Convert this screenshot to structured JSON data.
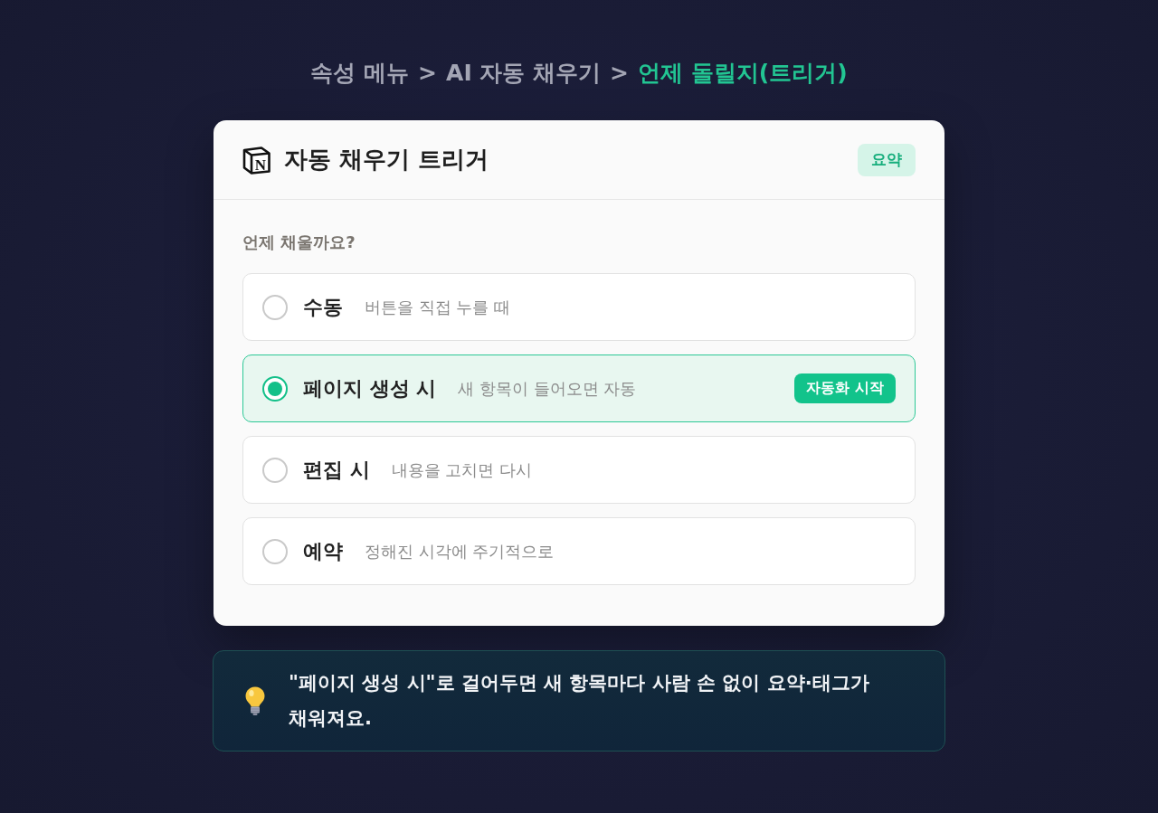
{
  "breadcrumb": [
    {
      "label": "속성 메뉴",
      "current": false
    },
    {
      "separator": ">",
      "label": "AI 자동 채우기",
      "current": false
    },
    {
      "separator": ">",
      "label": "언제 돌릴지(트리거)",
      "current": true
    }
  ],
  "card": {
    "logo_letter": "N",
    "title": "자동 채우기 트리거",
    "badge": "요약",
    "question": "언제 채울까요?",
    "options": [
      {
        "label": "수동",
        "description": "버튼을 직접 누를 때",
        "selected": false
      },
      {
        "label": "페이지 생성 시",
        "description": "새 항목이 들어오면 자동",
        "selected": true,
        "badge": "자동화 시작"
      },
      {
        "label": "편집 시",
        "description": "내용을 고치면 다시",
        "selected": false
      },
      {
        "label": "예약",
        "description": "정해진 시각에 주기적으로",
        "selected": false
      }
    ]
  },
  "tip": {
    "text": "**\"페이지 생성 시\"**로 걸어두면 새 항목마다 사람 손 없이 요약·태그가 채워져요."
  }
}
